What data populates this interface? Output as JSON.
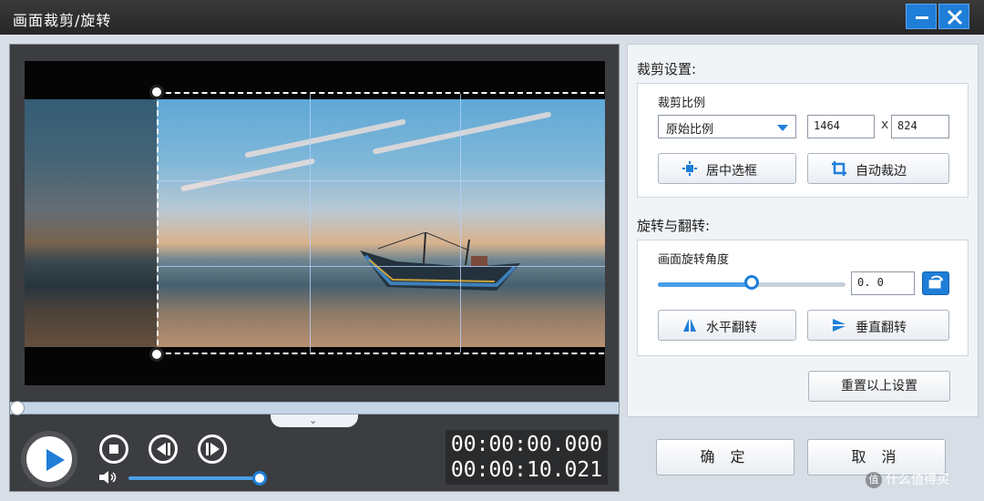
{
  "window": {
    "title": "画面裁剪/旋转"
  },
  "crop_settings": {
    "section_title": "裁剪设置:",
    "ratio_label": "裁剪比例",
    "ratio_value": "原始比例",
    "width": "1464",
    "height": "824",
    "times": "x",
    "center_button": "居中选框",
    "auto_button": "自动裁边"
  },
  "rotate_settings": {
    "section_title": "旋转与翻转:",
    "angle_label": "画面旋转角度",
    "angle_value": "0. 0",
    "angle_slider_fraction": 0.5,
    "hflip_button": "水平翻转",
    "vflip_button": "垂直翻转"
  },
  "reset_button": "重置以上设置",
  "ok_button": "确 定",
  "cancel_button": "取 消",
  "player": {
    "current_time": "00:00:00.000",
    "total_time": "00:00:10.021",
    "volume_fraction": 1.0,
    "progress_fraction": 0.0
  },
  "watermark": "什么值得买",
  "colors": {
    "accent": "#1f7ed8",
    "titlebar": "#2b2b2b"
  }
}
